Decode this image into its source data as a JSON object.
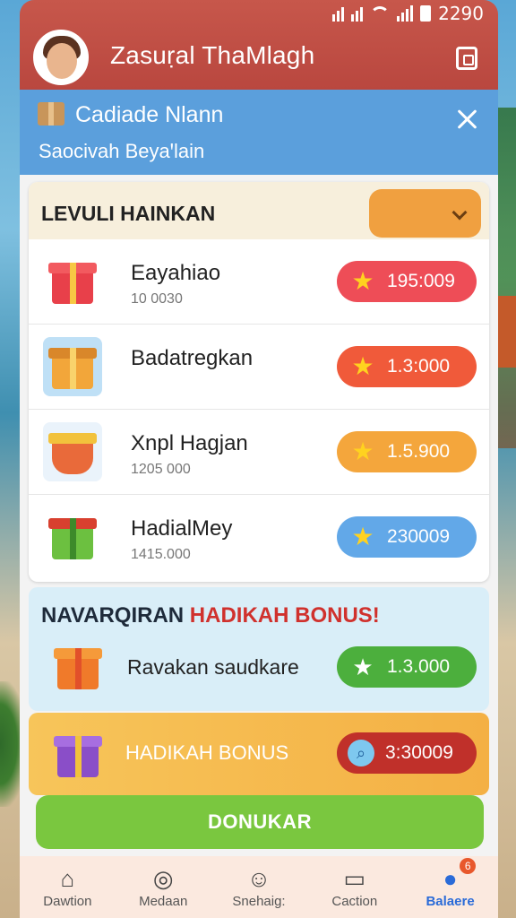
{
  "status_bar": {
    "time": "2290"
  },
  "header": {
    "title": "Zasuṛal ThaMlagh"
  },
  "notice": {
    "title": "Cadiade Nlann",
    "subtitle": "Saocivah Beyaꞌlain"
  },
  "level_card": {
    "title": "LEVULI HAINKAN",
    "rows": [
      {
        "name": "Eayahiao",
        "sub": "10 0030",
        "points": "195:009",
        "color": "#ee4d57"
      },
      {
        "name": "Badatregkan",
        "sub": "",
        "points": "1.3:000",
        "color": "#f05a3a"
      },
      {
        "name": "Xnpl Hagjan",
        "sub": "1205 000",
        "points": "1.5.900",
        "color": "#f4a63c"
      },
      {
        "name": "HadialMey",
        "sub": "1415.000",
        "points": "230009",
        "color": "#62a8e8"
      }
    ]
  },
  "bonus_card": {
    "title_prefix": "NAVARQIRAN",
    "title_highlight": "HADIKAH BONUS!",
    "item_name": "Ravakan saudkare",
    "points": "1.3.000"
  },
  "hadikah_card": {
    "label": "HADIKAH BONUS",
    "points": "3:30009"
  },
  "cta": {
    "label": "DONUKAR"
  },
  "bottom_nav": [
    {
      "label": "Dawtion",
      "icon": "home-icon"
    },
    {
      "label": "Medaan",
      "icon": "globe-icon"
    },
    {
      "label": "Snehaig:",
      "icon": "smile-icon"
    },
    {
      "label": "Caction",
      "icon": "chat-icon"
    },
    {
      "label": "Balaere",
      "icon": "profile-icon",
      "badge": "6",
      "active": true
    }
  ],
  "colors": {
    "header": "#bd4c43",
    "notice": "#5b9fdc",
    "cta": "#7ac73f",
    "active_nav": "#2a6bd8"
  }
}
